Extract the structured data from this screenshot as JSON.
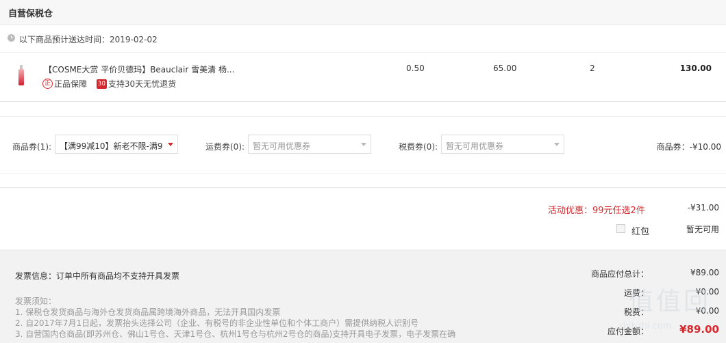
{
  "section": {
    "title": "自营保税仓"
  },
  "delivery": {
    "text": "以下商品预计送达时间：2019-02-02"
  },
  "item": {
    "name": "【COSME大赏 平价贝德玛】Beauclair 雪美清 杨...",
    "badge_genuine_icon": "正",
    "badge_genuine_label": "正品保障",
    "badge_return_icon": "30",
    "badge_return_label": "支持30天无忧退货",
    "tax": "0.50",
    "price": "65.00",
    "quantity": "2",
    "subtotal": "130.00"
  },
  "coupons": {
    "product_label": "商品券(1):",
    "product_value": "【满99减10】新老不限-满9...",
    "shipping_label": "运费券(0):",
    "shipping_value": "暂无可用优惠券",
    "tax_label": "税费券(0):",
    "tax_value": "暂无可用优惠券",
    "product_total": "商品券：-¥10.00"
  },
  "promo": {
    "activity_label": "活动优惠：99元任选2件",
    "activity_value": "-¥31.00",
    "redpacket_label": "红包",
    "redpacket_value": "暂无可用"
  },
  "footer": {
    "invoice": "发票信息：订单中所有商品均不支持开具发票",
    "notes_title": "发票须知：",
    "notes": [
      "1. 保税仓发货商品与海外仓发货商品属跨境海外商品，无法开具国内发票",
      "2. 自2017年7月1日起，发票抬头选择公司（企业、有税号的非企业性单位和个体工商户）需提供纳税人识别号",
      "3. 自营国内仓商品(即苏州仓、佛山1号仓、天津1号仓、杭州1号仓与杭州2号仓的商品)支持开具电子发票，电子发票在确"
    ],
    "summary": {
      "goods_label": "商品应付总计：",
      "goods_value": "¥89.00",
      "shipping_label": "运费：",
      "shipping_value": "¥0.00",
      "tax_label": "税费：",
      "tax_value": "¥0.00",
      "payable_label": "应付金额：",
      "payable_value": "¥89.00"
    }
  },
  "watermark": {
    "glyphs": "值值回",
    "url": "zhihzhi.com"
  },
  "colors": {
    "accent": "#d4282d",
    "footer_bg": "#f2f2f2"
  }
}
